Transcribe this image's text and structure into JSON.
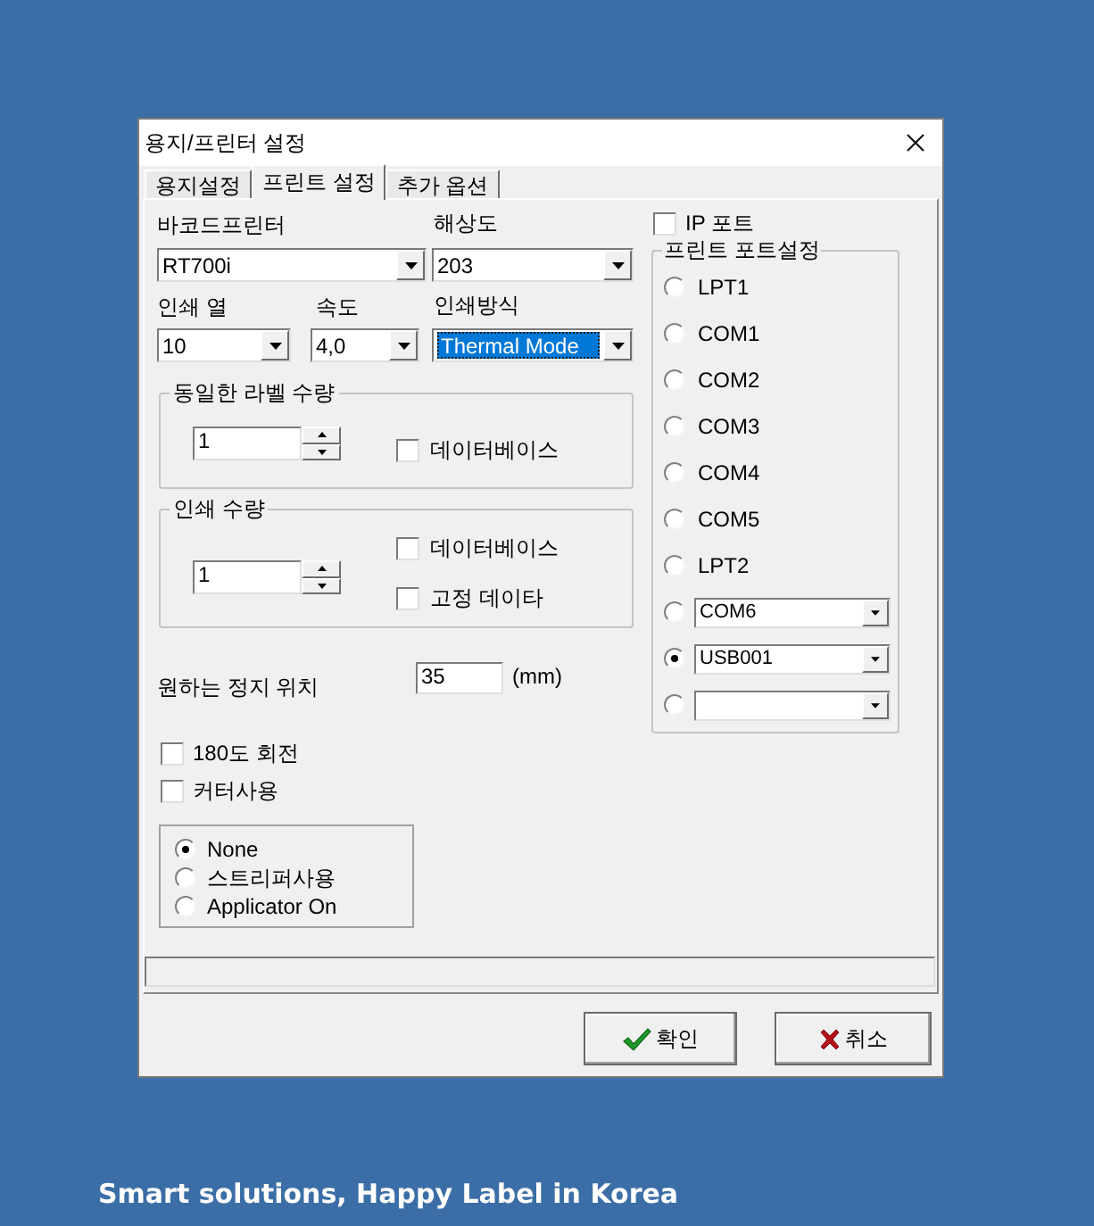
{
  "window": {
    "title": "용지/프린터 설정"
  },
  "tabs": [
    {
      "label": "용지설정",
      "selected": false
    },
    {
      "label": "프린트 설정",
      "selected": true
    },
    {
      "label": "추가 옵션",
      "selected": false
    }
  ],
  "printer": {
    "label": "바코드프린터",
    "value": "RT700i"
  },
  "resolution": {
    "label": "해상도",
    "value": "203"
  },
  "print_column": {
    "label": "인쇄 열",
    "value": "10"
  },
  "speed": {
    "label": "속도",
    "value": "4,0"
  },
  "print_method": {
    "label": "인쇄방식",
    "value": "Thermal Mode",
    "highlighted": true
  },
  "same_label_qty": {
    "title": "동일한 라벨 수량",
    "value": "1",
    "database": {
      "label": "데이터베이스",
      "checked": false
    }
  },
  "print_qty": {
    "title": "인쇄 수량",
    "value": "1",
    "checkboxes": [
      {
        "label": "데이터베이스",
        "checked": false
      },
      {
        "label": "고정 데이타",
        "checked": false
      }
    ]
  },
  "stop_position": {
    "label": "원하는 정지 위치",
    "value": "35",
    "unit": "(mm)"
  },
  "options": [
    {
      "label": "180도 회전",
      "checked": false
    },
    {
      "label": "커터사용",
      "checked": false
    }
  ],
  "mode_radios": [
    {
      "label": "None",
      "selected": true
    },
    {
      "label": "스트리퍼사용",
      "selected": false
    },
    {
      "label": "Applicator On",
      "selected": false
    }
  ],
  "ip_port": {
    "label": "IP 포트",
    "checked": false
  },
  "port_group": {
    "title": "프린트 포트설정",
    "ports": [
      {
        "kind": "radio",
        "label": "LPT1",
        "selected": false
      },
      {
        "kind": "radio",
        "label": "COM1",
        "selected": false
      },
      {
        "kind": "radio",
        "label": "COM2",
        "selected": false
      },
      {
        "kind": "radio",
        "label": "COM3",
        "selected": false
      },
      {
        "kind": "radio",
        "label": "COM4",
        "selected": false
      },
      {
        "kind": "radio",
        "label": "COM5",
        "selected": false
      },
      {
        "kind": "radio",
        "label": "LPT2",
        "selected": false
      },
      {
        "kind": "combo",
        "value": "COM6",
        "selected": false
      },
      {
        "kind": "combo",
        "value": "USB001",
        "selected": true
      },
      {
        "kind": "combo",
        "selected": false
      }
    ]
  },
  "buttons": [
    {
      "kind": "ok",
      "label": "확인"
    },
    {
      "kind": "cancel",
      "label": "취소"
    }
  ],
  "caption": "Smart solutions, Happy Label in Korea"
}
